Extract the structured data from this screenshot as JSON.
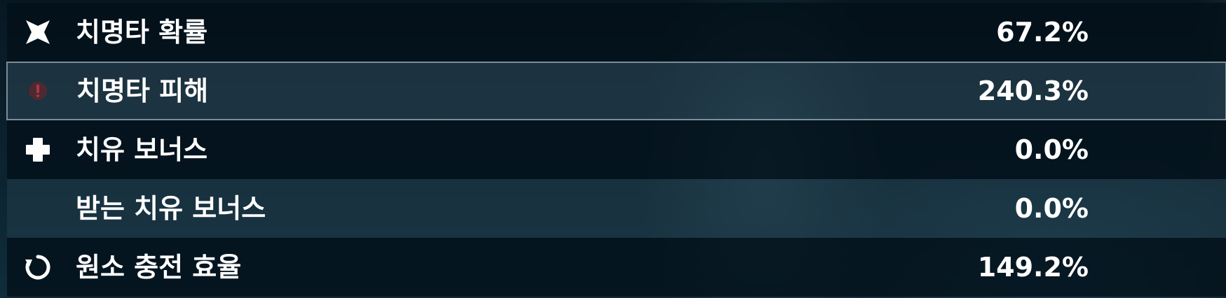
{
  "stats": [
    {
      "label": "치명타 확률",
      "value": "67.2%",
      "icon": "crit-rate-icon",
      "state": "dark"
    },
    {
      "label": "치명타 피해",
      "value": "240.3%",
      "icon": "crit-dmg-icon",
      "state": "selected"
    },
    {
      "label": "치유 보너스",
      "value": "0.0%",
      "icon": "healing-bonus-icon",
      "state": "dark"
    },
    {
      "label": "받는 치유 보너스",
      "value": "0.0%",
      "icon": "",
      "state": "light"
    },
    {
      "label": "원소 충전 효율",
      "value": "149.2%",
      "icon": "energy-recharge-icon",
      "state": "dark"
    }
  ],
  "colors": {
    "text": "#ffffff",
    "selected_border": "#c8d7e1",
    "background": "#0b1f2b"
  }
}
